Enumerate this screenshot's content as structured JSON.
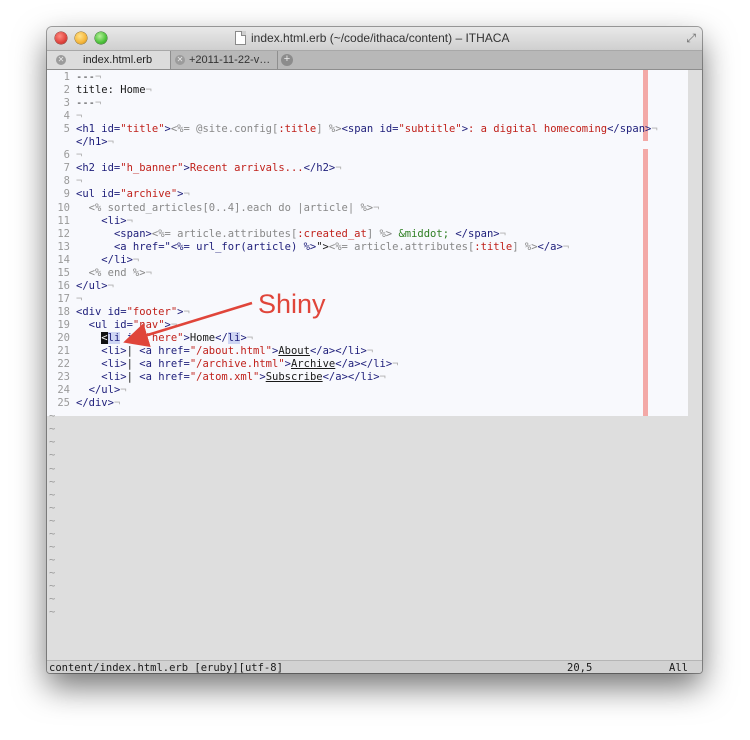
{
  "window": {
    "title": "index.html.erb (~/code/ithaca/content) – ITHACA"
  },
  "tabs": [
    {
      "label": "index.html.erb",
      "active": true
    },
    {
      "label": "+2011-11-22-v…",
      "active": false
    }
  ],
  "statusbar": {
    "file": "content/index.html.erb [eruby][utf-8]",
    "position": "20,5",
    "scroll": "All"
  },
  "annotation": {
    "label": "Shiny",
    "color": "#e0453a"
  },
  "editor": {
    "colors": {
      "background": "#f8f9fd",
      "colorcolumn": "#f3a9a7",
      "tag": "#1e1e7a",
      "string": "#c0211b",
      "entity": "#2f7f23"
    },
    "lines": [
      {
        "n": "1",
        "t": "---"
      },
      {
        "n": "2",
        "t": "title: Home"
      },
      {
        "n": "3",
        "t": "---"
      },
      {
        "n": "4",
        "t": ""
      },
      {
        "n": "5",
        "t": "<h1 id=\"title\"><%= @site.config[:title] %><span id=\"subtitle\">: a digital homecoming</span>"
      },
      {
        "n": "",
        "t": "</h1>"
      },
      {
        "n": "6",
        "t": ""
      },
      {
        "n": "7",
        "t": "<h2 id=\"h_banner\">Recent arrivals...</h2>"
      },
      {
        "n": "8",
        "t": ""
      },
      {
        "n": "9",
        "t": "<ul id=\"archive\">"
      },
      {
        "n": "10",
        "t": "  <% sorted_articles[0..4].each do |article| %>"
      },
      {
        "n": "11",
        "t": "    <li>"
      },
      {
        "n": "12",
        "t": "      <span><%= article.attributes[:created_at] %> &middot; </span>"
      },
      {
        "n": "13",
        "t": "      <a href=\"<%= url_for(article) %>\"><%= article.attributes[:title] %></a>"
      },
      {
        "n": "14",
        "t": "    </li>"
      },
      {
        "n": "15",
        "t": "  <% end %>"
      },
      {
        "n": "16",
        "t": "</ul>"
      },
      {
        "n": "17",
        "t": ""
      },
      {
        "n": "18",
        "t": "<div id=\"footer\">"
      },
      {
        "n": "19",
        "t": "  <ul id=\"nav\">"
      },
      {
        "n": "20",
        "t": "    <li id=\"here\">Home</li>"
      },
      {
        "n": "21",
        "t": "    <li>| <a href=\"/about.html\">About</a></li>"
      },
      {
        "n": "22",
        "t": "    <li>| <a href=\"/archive.html\">Archive</a></li>"
      },
      {
        "n": "23",
        "t": "    <li>| <a href=\"/atom.xml\">Subscribe</a></li>"
      },
      {
        "n": "24",
        "t": "  </ul>"
      },
      {
        "n": "25",
        "t": "</div>"
      }
    ],
    "filler": "~"
  }
}
